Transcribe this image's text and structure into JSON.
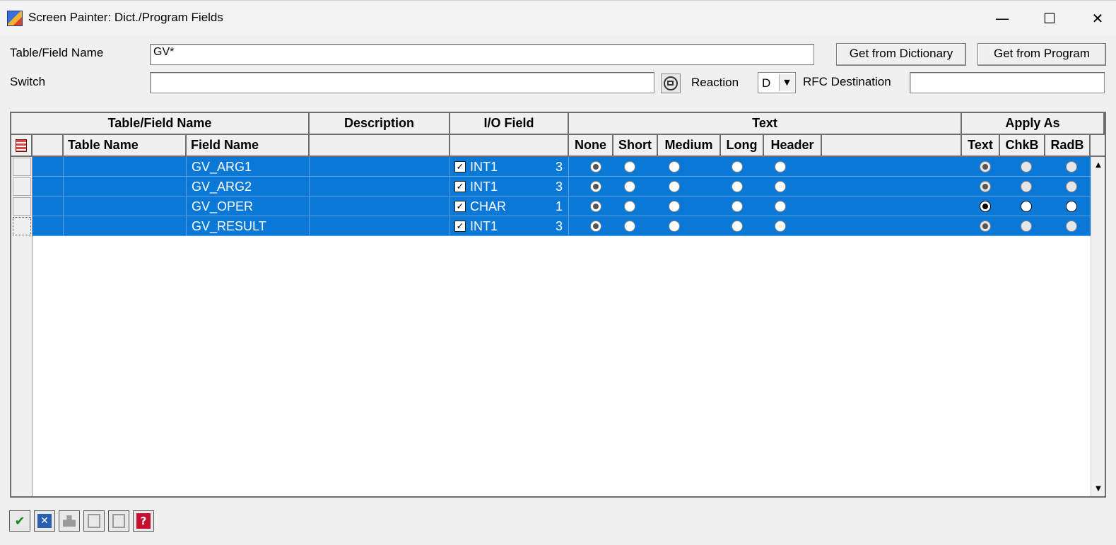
{
  "window": {
    "title": "Screen Painter: Dict./Program Fields",
    "min_icon": "—",
    "max_icon": "☐",
    "close_icon": "✕"
  },
  "form": {
    "table_field_label": "Table/Field Name",
    "table_field_value": "GV*",
    "switch_label": "Switch",
    "switch_value": "",
    "reaction_label": "Reaction",
    "reaction_value": "D",
    "rfc_label": "RFC Destination",
    "rfc_value": "",
    "get_dict_label": "Get from Dictionary",
    "get_prog_label": "Get from Program"
  },
  "grid": {
    "group_headers": {
      "table_field": "Table/Field Name",
      "description": "Description",
      "io_field": "I/O Field",
      "text": "Text",
      "apply_as": "Apply As"
    },
    "col_headers": {
      "table_name": "Table Name",
      "field_name": "Field Name",
      "none": "None",
      "short": "Short",
      "medium": "Medium",
      "long": "Long",
      "header": "Header",
      "text": "Text",
      "chkb": "ChkB",
      "radb": "RadB"
    },
    "rows": [
      {
        "field": "GV_ARG1",
        "type": "INT1",
        "length": "3",
        "io_checked": true,
        "text_choice": "none",
        "apply_as": "none"
      },
      {
        "field": "GV_ARG2",
        "type": "INT1",
        "length": "3",
        "io_checked": true,
        "text_choice": "none",
        "apply_as": "none"
      },
      {
        "field": "GV_OPER",
        "type": "CHAR",
        "length": "1",
        "io_checked": true,
        "text_choice": "none",
        "apply_as": "text"
      },
      {
        "field": "GV_RESULT",
        "type": "INT1",
        "length": "3",
        "io_checked": true,
        "text_choice": "none",
        "apply_as": "none"
      }
    ]
  },
  "toolbar": {
    "ok_icon": "✔",
    "cancel_icon": "✕",
    "help_icon": "?"
  }
}
